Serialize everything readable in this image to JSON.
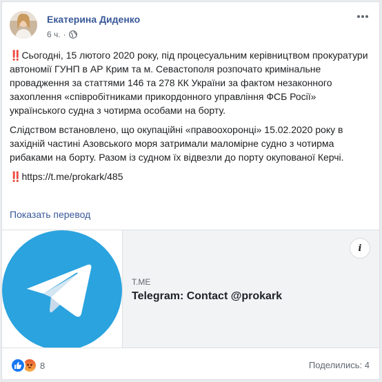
{
  "post": {
    "author": "Екатерина Диденко",
    "time": "6 ч.",
    "dot": "·",
    "p1_text": "Сьогодні, 15 лютого 2020 року, під процесуальним керівництвом прокуратури автономії ГУНП в АР Крим та м. Севастополя розпочато кримінальне провадження за статтями 146 та 278 КК України за фактом незаконного захоплення «співробітниками прикордонного управління ФСБ Росії» українського судна з чотирма особами на борту.",
    "p2_text": "Слідством встановлено, що окупаційні «правоохоронці» 15.02.2020 року в західній частині Азовського моря затримали маломірне судно з чотирма рибаками на борту. Разом із судном їх відвезли до порту окупованої Керчі.",
    "p3_text": "https://t.me/prokark/485",
    "excl": "‼️",
    "translate": "Показать перевод"
  },
  "link_preview": {
    "domain": "T.ME",
    "title": "Telegram: Contact @prokark",
    "info": "i"
  },
  "footer": {
    "reaction_count": "8",
    "shares": "Поделились: 4"
  },
  "icons": {
    "reaction1": "like-icon",
    "reaction2": "angry-icon",
    "telegram": "telegram-logo-icon"
  },
  "colors": {
    "author": "#385898",
    "telegram": "#2aa3df",
    "like": "#1877f2",
    "angry": "#e9710f"
  }
}
